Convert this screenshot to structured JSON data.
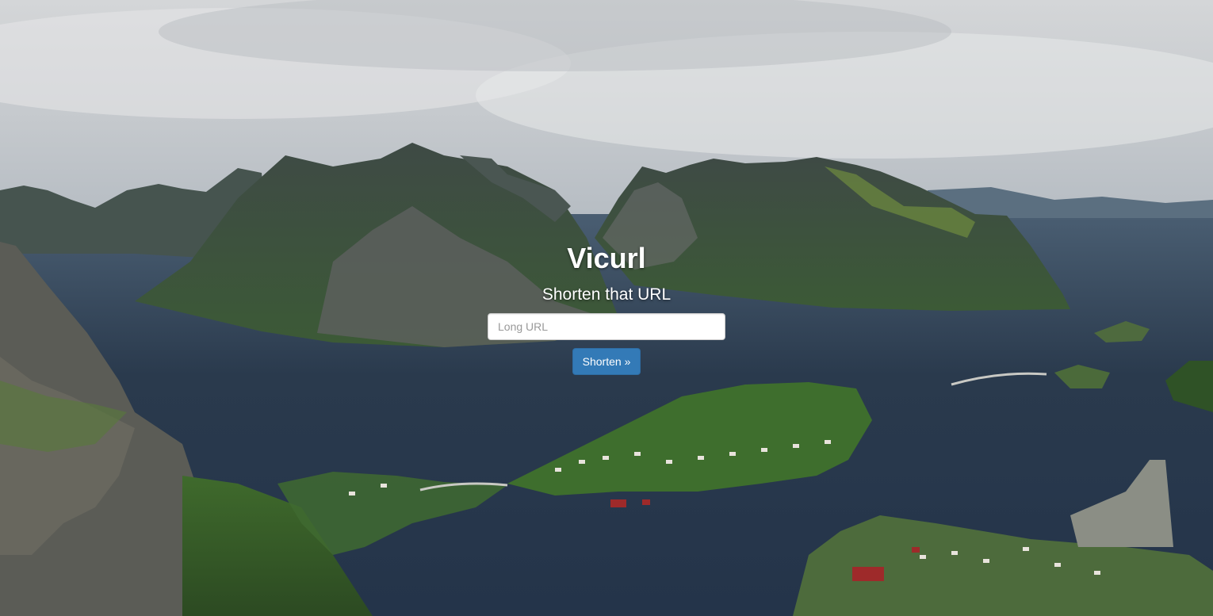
{
  "hero": {
    "title": "Vicurl",
    "subtitle": "Shorten that URL",
    "url_input": {
      "value": "",
      "placeholder": "Long URL"
    },
    "shorten_button_label": "Shorten »",
    "background_image": "fjord-mountain-landscape"
  },
  "colors": {
    "primary_button": "#337ab7",
    "title_text": "#ffffff"
  }
}
